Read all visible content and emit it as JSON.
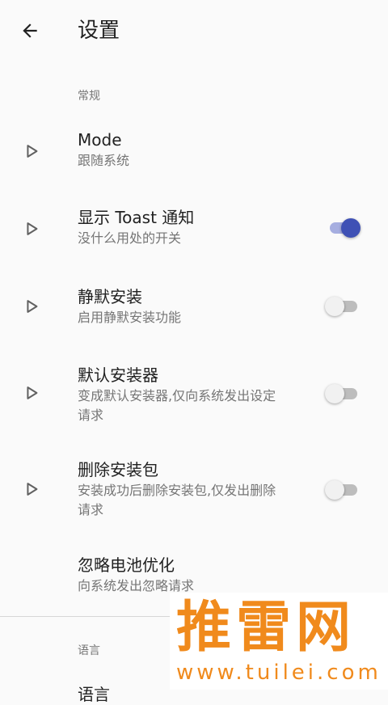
{
  "appbar": {
    "title": "设置",
    "back_icon": "arrow-back-icon"
  },
  "sections": {
    "general": "常规",
    "language": "语言"
  },
  "prefs": [
    {
      "title": "Mode",
      "summary": "跟随系统",
      "icon": "play-triangle-icon"
    },
    {
      "title": "显示 Toast 通知",
      "summary": "没什么用处的开关",
      "icon": "play-triangle-icon",
      "switch": true
    },
    {
      "title": "静默安装",
      "summary": "启用静默安装功能",
      "icon": "play-triangle-icon",
      "switch": false
    },
    {
      "title": "默认安装器",
      "summary": "变成默认安装器,仅向系统发出设定请求",
      "icon": "play-triangle-icon",
      "switch": false
    },
    {
      "title": "删除安装包",
      "summary": "安装成功后删除安装包,仅发出删除请求",
      "icon": "play-triangle-icon",
      "switch": false
    },
    {
      "title": "忽略电池优化",
      "summary": "向系统发出忽略请求"
    }
  ],
  "language_pref": {
    "title": "语言"
  },
  "watermark": {
    "title": "推雷网",
    "url": "www.tuilei.com"
  },
  "colors": {
    "accent": "#3f51b5",
    "watermark": "#f08a1c"
  }
}
